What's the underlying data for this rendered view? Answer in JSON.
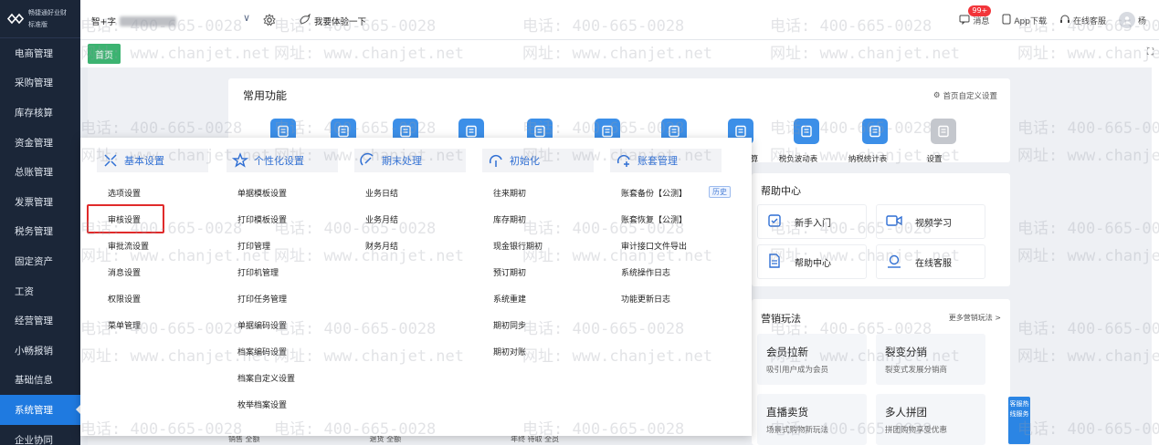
{
  "app": {
    "brand": "畅捷通好业财",
    "edition": "标准版"
  },
  "sidebar": {
    "items": [
      {
        "label": "电商管理",
        "active": false
      },
      {
        "label": "采购管理",
        "active": false
      },
      {
        "label": "库存核算",
        "active": false
      },
      {
        "label": "资金管理",
        "active": false
      },
      {
        "label": "总账管理",
        "active": false
      },
      {
        "label": "发票管理",
        "active": false
      },
      {
        "label": "税务管理",
        "active": false
      },
      {
        "label": "固定资产",
        "active": false
      },
      {
        "label": "工资",
        "active": false
      },
      {
        "label": "经营管理",
        "active": false
      },
      {
        "label": "小畅报销",
        "active": false
      },
      {
        "label": "基础信息",
        "active": false
      },
      {
        "label": "系统管理",
        "active": true
      },
      {
        "label": "企业协同",
        "active": false
      }
    ]
  },
  "topbar": {
    "account_prefix": "智+字",
    "experience": "我要体验一下",
    "messages_label": "消息",
    "messages_badge": "99+",
    "app_download": "App下载",
    "online_service": "在线客服",
    "user_initial": "杨"
  },
  "tabs": {
    "home": "首页"
  },
  "common": {
    "title": "常用功能",
    "customize": "首页自定义设置",
    "visible_labels": [
      "算",
      "税负波动表",
      "纳税统计表",
      "设置"
    ]
  },
  "help": {
    "title": "帮助中心",
    "items": [
      "新手入门",
      "视频学习",
      "帮助中心",
      "在线客服"
    ]
  },
  "marketing": {
    "title": "营销玩法",
    "more": "更多营销玩法 >",
    "items": [
      {
        "title": "会员拉新",
        "sub": "吸引用户成为会员"
      },
      {
        "title": "裂变分销",
        "sub": "裂变式发展分销商"
      },
      {
        "title": "直播卖货",
        "sub": "场景式购物新玩法"
      },
      {
        "title": "多人拼团",
        "sub": "拼团购物享受优惠"
      }
    ]
  },
  "hotline": {
    "label": "客服热线服务"
  },
  "menu": {
    "columns": [
      {
        "header": "基本设置",
        "icon": "basic-settings-icon",
        "items": [
          "选项设置",
          "审核设置",
          "审批流设置",
          "消息设置",
          "权限设置",
          "菜单管理"
        ]
      },
      {
        "header": "个性化设置",
        "icon": "personalize-icon",
        "items": [
          "单据模板设置",
          "打印模板设置",
          "打印管理",
          "打印机管理",
          "打印任务管理",
          "单据编码设置",
          "档案编码设置",
          "档案自定义设置",
          "枚举档案设置"
        ]
      },
      {
        "header": "期末处理",
        "icon": "period-end-icon",
        "items": [
          "业务日结",
          "业务月结",
          "财务月结"
        ]
      },
      {
        "header": "初始化",
        "icon": "initialize-icon",
        "items": [
          "往来期初",
          "库存期初",
          "现金银行期初",
          "预订期初",
          "系统重建",
          "期初同步",
          "期初对账"
        ]
      },
      {
        "header": "账套管理",
        "icon": "account-set-icon",
        "items": [
          "账套备份【公测】",
          "账套恢复【公测】",
          "审计接口文件导出",
          "系统操作日志",
          "功能更新日志"
        ],
        "history_tag": "历史"
      }
    ],
    "highlighted": "审核设置"
  },
  "watermark": {
    "phone": "电话: 400-665-0028",
    "site": "网址: www.chanjet.net"
  },
  "bottom_hints": [
    "销售 全额",
    "退货 全额",
    "年终 待取 全员"
  ],
  "colors": {
    "sidebar": "#1b2638",
    "active": "#1f7ae0",
    "accent": "#2f6fd4",
    "highlight": "#e02a2a",
    "home_tab": "#3cb371"
  }
}
